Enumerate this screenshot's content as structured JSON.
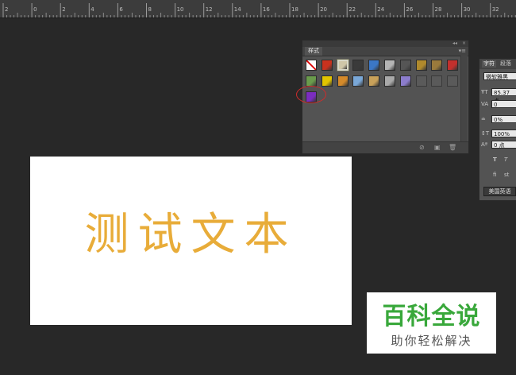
{
  "ruler": {
    "labels": [
      "2",
      "0",
      "2",
      "4",
      "6",
      "8",
      "10",
      "12",
      "14",
      "16",
      "18",
      "20",
      "22",
      "24",
      "26",
      "28",
      "30",
      "32",
      "34"
    ]
  },
  "styles_panel": {
    "tab_label": "样式",
    "collapse_glyph": "◂◂",
    "close_glyph": "×",
    "menu_glyph": "▾≡",
    "swatches": [
      {
        "name": "style-none",
        "color": "#ffffff"
      },
      {
        "name": "style-red-glow",
        "color": "#c8321e"
      },
      {
        "name": "style-beige-frame",
        "color": "#cfc7a8"
      },
      {
        "name": "style-dark-gloss",
        "color": "#3a3a3a"
      },
      {
        "name": "style-blue-gloss",
        "color": "#3b77c6"
      },
      {
        "name": "style-grey-bevel",
        "color": "#b4b4b4"
      },
      {
        "name": "style-dark-steel",
        "color": "#555555"
      },
      {
        "name": "style-gold",
        "color": "#b08a2c"
      },
      {
        "name": "style-bronze",
        "color": "#9a7a3c"
      },
      {
        "name": "style-red-bevel",
        "color": "#c2302d"
      },
      {
        "name": "style-rainbow",
        "color": "#6a9b4c"
      },
      {
        "name": "style-yellow-frame",
        "color": "#e2c400"
      },
      {
        "name": "style-orange",
        "color": "#d48a2a"
      },
      {
        "name": "style-sky",
        "color": "#7aa8d8"
      },
      {
        "name": "style-sunset",
        "color": "#c8a15a"
      },
      {
        "name": "style-silver-x",
        "color": "#a9a9a9"
      },
      {
        "name": "style-lavender",
        "color": "#8c7dcc"
      },
      {
        "name": "style-empty-1",
        "color": "#5a5a5a"
      },
      {
        "name": "style-empty-2",
        "color": "#5a5a5a"
      },
      {
        "name": "style-empty-3",
        "color": "#5a5a5a"
      },
      {
        "name": "style-purple",
        "color": "#7b2dc0"
      }
    ],
    "footer_icons": [
      "no-style-icon",
      "new-style-icon",
      "delete-style-icon"
    ]
  },
  "character_panel": {
    "tabs": [
      "字符",
      "段落"
    ],
    "font_family": "微软雅黑",
    "font_size": "85.37 点",
    "kerning": "0",
    "tracking": "0%",
    "vertical_scale": "100%",
    "baseline_shift": "0 点",
    "language": "美国英语"
  },
  "canvas": {
    "text": "测试文本",
    "text_color": "#e8ac39"
  },
  "watermark": {
    "title": "百科全说",
    "subtitle": "助你轻松解决",
    "title_color": "#39a83b"
  }
}
